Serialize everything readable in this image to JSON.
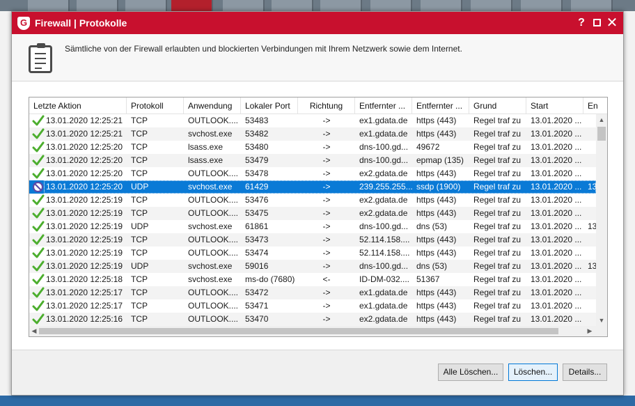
{
  "colors": {
    "title_bar": "#c8102e",
    "selection": "#0a7ad6",
    "check_green": "#4cae2e",
    "blocked_purple": "#5a4aa8"
  },
  "window": {
    "title": "Firewall | Protokolle",
    "logo_letter": "G",
    "help_label": "?",
    "close_label": "✕"
  },
  "header": {
    "icon": "clipboard-icon",
    "description": "Sämtliche von der Firewall erlaubten und blockierten Verbindungen mit Ihrem Netzwerk sowie dem Internet."
  },
  "table": {
    "columns": [
      "Letzte Aktion",
      "Protokoll",
      "Anwendung",
      "Lokaler Port",
      "Richtung",
      "Entfernter ...",
      "Entfernter ...",
      "Grund",
      "Start",
      "En"
    ],
    "rows": [
      {
        "status": "allowed",
        "time": "13.01.2020 12:25:21",
        "protocol": "TCP",
        "app": "OUTLOOK....",
        "port": "53483",
        "direction": "->",
        "remote_host": "ex1.gdata.de",
        "remote_port": "https (443)",
        "reason": "Regel traf zu",
        "start": "13.01.2020 ...",
        "end": ""
      },
      {
        "status": "allowed",
        "time": "13.01.2020 12:25:21",
        "protocol": "TCP",
        "app": "svchost.exe",
        "port": "53482",
        "direction": "->",
        "remote_host": "ex1.gdata.de",
        "remote_port": "https (443)",
        "reason": "Regel traf zu",
        "start": "13.01.2020 ...",
        "end": ""
      },
      {
        "status": "allowed",
        "time": "13.01.2020 12:25:20",
        "protocol": "TCP",
        "app": "lsass.exe",
        "port": "53480",
        "direction": "->",
        "remote_host": "dns-100.gd...",
        "remote_port": "49672",
        "reason": "Regel traf zu",
        "start": "13.01.2020 ...",
        "end": ""
      },
      {
        "status": "allowed",
        "time": "13.01.2020 12:25:20",
        "protocol": "TCP",
        "app": "lsass.exe",
        "port": "53479",
        "direction": "->",
        "remote_host": "dns-100.gd...",
        "remote_port": "epmap (135)",
        "reason": "Regel traf zu",
        "start": "13.01.2020 ...",
        "end": ""
      },
      {
        "status": "allowed",
        "time": "13.01.2020 12:25:20",
        "protocol": "TCP",
        "app": "OUTLOOK....",
        "port": "53478",
        "direction": "->",
        "remote_host": "ex2.gdata.de",
        "remote_port": "https (443)",
        "reason": "Regel traf zu",
        "start": "13.01.2020 ...",
        "end": ""
      },
      {
        "status": "blocked",
        "time": "13.01.2020 12:25:20",
        "protocol": "UDP",
        "app": "svchost.exe",
        "port": "61429",
        "direction": "->",
        "remote_host": "239.255.255....",
        "remote_port": "ssdp (1900)",
        "reason": "Regel traf zu",
        "start": "13.01.2020 ...",
        "end": "13"
      },
      {
        "status": "allowed",
        "time": "13.01.2020 12:25:19",
        "protocol": "TCP",
        "app": "OUTLOOK....",
        "port": "53476",
        "direction": "->",
        "remote_host": "ex2.gdata.de",
        "remote_port": "https (443)",
        "reason": "Regel traf zu",
        "start": "13.01.2020 ...",
        "end": ""
      },
      {
        "status": "allowed",
        "time": "13.01.2020 12:25:19",
        "protocol": "TCP",
        "app": "OUTLOOK....",
        "port": "53475",
        "direction": "->",
        "remote_host": "ex2.gdata.de",
        "remote_port": "https (443)",
        "reason": "Regel traf zu",
        "start": "13.01.2020 ...",
        "end": ""
      },
      {
        "status": "allowed",
        "time": "13.01.2020 12:25:19",
        "protocol": "UDP",
        "app": "svchost.exe",
        "port": "61861",
        "direction": "->",
        "remote_host": "dns-100.gd...",
        "remote_port": "dns (53)",
        "reason": "Regel traf zu",
        "start": "13.01.2020 ...",
        "end": "13"
      },
      {
        "status": "allowed",
        "time": "13.01.2020 12:25:19",
        "protocol": "TCP",
        "app": "OUTLOOK....",
        "port": "53473",
        "direction": "->",
        "remote_host": "52.114.158....",
        "remote_port": "https (443)",
        "reason": "Regel traf zu",
        "start": "13.01.2020 ...",
        "end": ""
      },
      {
        "status": "allowed",
        "time": "13.01.2020 12:25:19",
        "protocol": "TCP",
        "app": "OUTLOOK....",
        "port": "53474",
        "direction": "->",
        "remote_host": "52.114.158....",
        "remote_port": "https (443)",
        "reason": "Regel traf zu",
        "start": "13.01.2020 ...",
        "end": ""
      },
      {
        "status": "allowed",
        "time": "13.01.2020 12:25:19",
        "protocol": "UDP",
        "app": "svchost.exe",
        "port": "59016",
        "direction": "->",
        "remote_host": "dns-100.gd...",
        "remote_port": "dns (53)",
        "reason": "Regel traf zu",
        "start": "13.01.2020 ...",
        "end": "13"
      },
      {
        "status": "allowed",
        "time": "13.01.2020 12:25:18",
        "protocol": "TCP",
        "app": "svchost.exe",
        "port": "ms-do (7680)",
        "direction": "<-",
        "remote_host": "ID-DM-032....",
        "remote_port": "51367",
        "reason": "Regel traf zu",
        "start": "13.01.2020 ...",
        "end": ""
      },
      {
        "status": "allowed",
        "time": "13.01.2020 12:25:17",
        "protocol": "TCP",
        "app": "OUTLOOK....",
        "port": "53472",
        "direction": "->",
        "remote_host": "ex1.gdata.de",
        "remote_port": "https (443)",
        "reason": "Regel traf zu",
        "start": "13.01.2020 ...",
        "end": ""
      },
      {
        "status": "allowed",
        "time": "13.01.2020 12:25:17",
        "protocol": "TCP",
        "app": "OUTLOOK....",
        "port": "53471",
        "direction": "->",
        "remote_host": "ex1.gdata.de",
        "remote_port": "https (443)",
        "reason": "Regel traf zu",
        "start": "13.01.2020 ...",
        "end": ""
      },
      {
        "status": "allowed",
        "time": "13.01.2020 12:25:16",
        "protocol": "TCP",
        "app": "OUTLOOK....",
        "port": "53470",
        "direction": "->",
        "remote_host": "ex2.gdata.de",
        "remote_port": "https (443)",
        "reason": "Regel traf zu",
        "start": "13.01.2020 ...",
        "end": ""
      }
    ],
    "selected_row": 5
  },
  "buttons": {
    "delete_all": "Alle Löschen...",
    "delete": "Löschen...",
    "details": "Details..."
  }
}
